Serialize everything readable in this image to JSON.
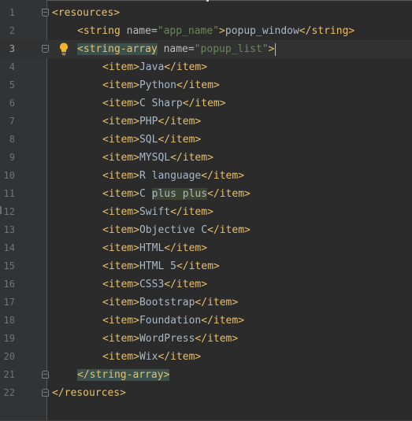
{
  "editor": {
    "lines": [
      {
        "n": "1",
        "open": "<resources>"
      },
      {
        "n": "2",
        "open": "<string",
        "attr": "name=",
        "val": "\"app_name\"",
        "mid": ">",
        "text": "popup_window",
        "close": "</string>"
      },
      {
        "n": "3",
        "open": "<string-array",
        "attr": "name=",
        "val": "\"popup_list\"",
        "mid": ">"
      },
      {
        "n": "4",
        "open": "<item>",
        "text": "Java",
        "close": "</item>"
      },
      {
        "n": "5",
        "open": "<item>",
        "text": "Python",
        "close": "</item>"
      },
      {
        "n": "6",
        "open": "<item>",
        "text": "C Sharp",
        "close": "</item>"
      },
      {
        "n": "7",
        "open": "<item>",
        "text": "PHP",
        "close": "</item>"
      },
      {
        "n": "8",
        "open": "<item>",
        "text": "SQL",
        "close": "</item>"
      },
      {
        "n": "9",
        "open": "<item>",
        "text": "MYSQL",
        "close": "</item>"
      },
      {
        "n": "10",
        "open": "<item>",
        "text": "R language",
        "close": "</item>"
      },
      {
        "n": "11",
        "open": "<item>",
        "text_a": "C ",
        "text_b": "plus plus",
        "close": "</item>"
      },
      {
        "n": "12",
        "open": "<item>",
        "text": "Swift",
        "close": "</item>"
      },
      {
        "n": "13",
        "open": "<item>",
        "text": "Objective C",
        "close": "</item>"
      },
      {
        "n": "14",
        "open": "<item>",
        "text": "HTML",
        "close": "</item>"
      },
      {
        "n": "15",
        "open": "<item>",
        "text": "HTML 5",
        "close": "</item>"
      },
      {
        "n": "16",
        "open": "<item>",
        "text": "CSS3",
        "close": "</item>"
      },
      {
        "n": "17",
        "open": "<item>",
        "text": "Bootstrap",
        "close": "</item>"
      },
      {
        "n": "18",
        "open": "<item>",
        "text": "Foundation",
        "close": "</item>"
      },
      {
        "n": "19",
        "open": "<item>",
        "text": "WordPress",
        "close": "</item>"
      },
      {
        "n": "20",
        "open": "<item>",
        "text": "Wix",
        "close": "</item>"
      },
      {
        "n": "21",
        "close": "</string-array>"
      },
      {
        "n": "22",
        "close": "</resources>"
      }
    ],
    "current_line": "3",
    "icons": {
      "intention": "lightbulb-icon",
      "fold": "fold-marker-icon"
    },
    "colors": {
      "background": "#2b2b2b",
      "gutter": "#313335",
      "tag": "#e8bf6a",
      "attribute": "#bababa",
      "value": "#6a8759",
      "text": "#a9b7c6",
      "line_number": "#6f737a",
      "tag_match_highlight": "#3b514d",
      "spelling_highlight": "#3e4432",
      "intention_bulb": "#f0b429"
    }
  }
}
